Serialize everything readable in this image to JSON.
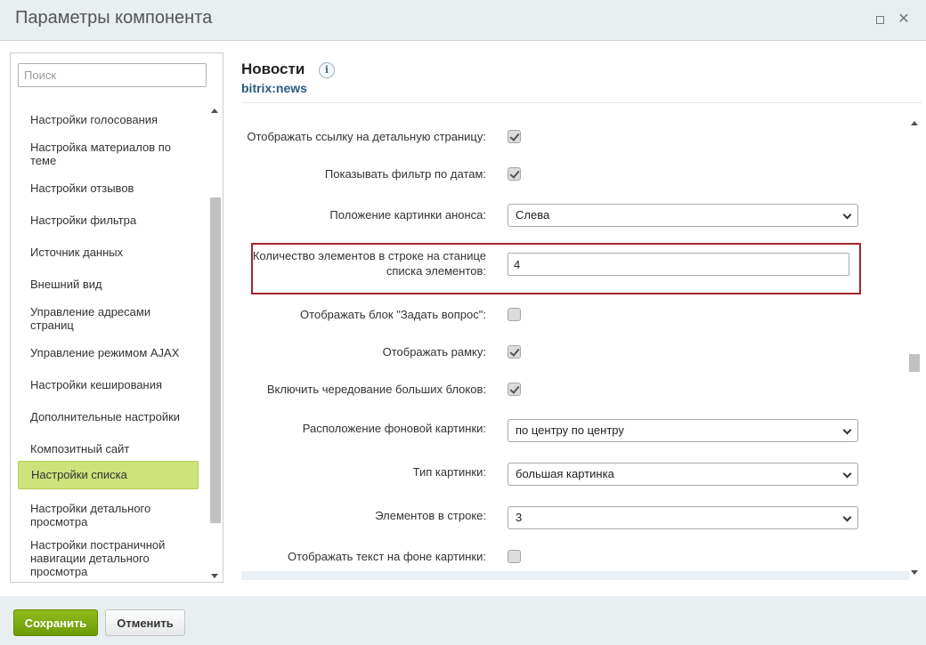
{
  "window": {
    "title": "Параметры компонента"
  },
  "sidebar": {
    "search_placeholder": "Поиск",
    "items": [
      {
        "label": "Настройки голосования"
      },
      {
        "label": "Настройка материалов по теме"
      },
      {
        "label": "Настройки отзывов"
      },
      {
        "label": "Настройки фильтра"
      },
      {
        "label": "Источник данных"
      },
      {
        "label": "Внешний вид"
      },
      {
        "label": "Управление адресами страниц"
      },
      {
        "label": "Управление режимом AJAX"
      },
      {
        "label": "Настройки кеширования"
      },
      {
        "label": "Дополнительные настройки"
      },
      {
        "label": "Композитный сайт"
      },
      {
        "label": "Настройки списка",
        "active": true
      },
      {
        "label": "Настройки детального просмотра"
      },
      {
        "label": "Настройки постраничной навигации детального просмотра"
      }
    ]
  },
  "component": {
    "name": "Новости",
    "code": "bitrix:news",
    "info_icon": "i"
  },
  "params": [
    {
      "label": "Отображать ссылку на детальную страницу:",
      "type": "checkbox",
      "checked": true
    },
    {
      "label": "Показывать фильтр по датам:",
      "type": "checkbox",
      "checked": true
    },
    {
      "label": "Положение картинки анонса:",
      "type": "select",
      "value": "Слева"
    },
    {
      "label": "Количество элементов в строке на станице списка элементов:",
      "type": "text",
      "value": "4",
      "highlighted": true
    },
    {
      "label": "Отображать блок \"Задать вопрос\":",
      "type": "checkbox",
      "checked": false
    },
    {
      "label": "Отображать рамку:",
      "type": "checkbox",
      "checked": true
    },
    {
      "label": "Включить чередование больших блоков:",
      "type": "checkbox",
      "checked": true
    },
    {
      "label": "Расположение фоновой картинки:",
      "type": "select",
      "value": "по центру по центру"
    },
    {
      "label": "Тип картинки:",
      "type": "select",
      "value": "большая картинка"
    },
    {
      "label": "Элементов в строке:",
      "type": "select",
      "value": "3"
    },
    {
      "label": "Отображать текст на фоне картинки:",
      "type": "checkbox",
      "checked": false
    }
  ],
  "footer": {
    "save_label": "Сохранить",
    "cancel_label": "Отменить"
  },
  "colors": {
    "active_nav": "#cde27a",
    "highlight_border": "#a3242f",
    "save_button": "#7aa90f",
    "link_blue": "#2a5a80"
  }
}
